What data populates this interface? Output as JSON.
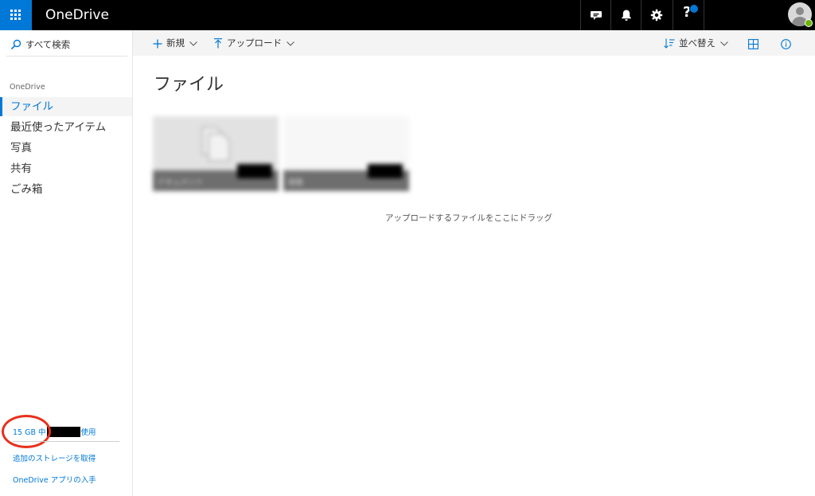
{
  "app": {
    "title": "OneDrive"
  },
  "topbar": {
    "icons": [
      "app-launcher-icon",
      "chat-icon",
      "bell-icon",
      "gear-icon",
      "help-icon",
      "avatar"
    ]
  },
  "leftnav": {
    "search_placeholder": "すべて検索",
    "section_label": "OneDrive",
    "items": [
      {
        "label": "ファイル",
        "selected": true
      },
      {
        "label": "最近使ったアイテム"
      },
      {
        "label": "写真"
      },
      {
        "label": "共有"
      },
      {
        "label": "ごみ箱"
      }
    ],
    "storage": {
      "prefix": "15 GB 中",
      "suffix": "使用"
    },
    "links": [
      "追加のストレージを取得",
      "OneDrive アプリの入手"
    ]
  },
  "commandbar": {
    "new_label": "新規",
    "upload_label": "アップロード",
    "sort_label": "並べ替え"
  },
  "main": {
    "title": "ファイル",
    "tiles": [
      {
        "label": "ドキュメント",
        "kind": "folder"
      },
      {
        "label": "画像",
        "kind": "folder"
      }
    ],
    "empty_message": "アップロードするファイルをここにドラッグ"
  },
  "colors": {
    "accent": "#0078d7",
    "topbar": "#000000",
    "annotation": "#e8301c"
  }
}
